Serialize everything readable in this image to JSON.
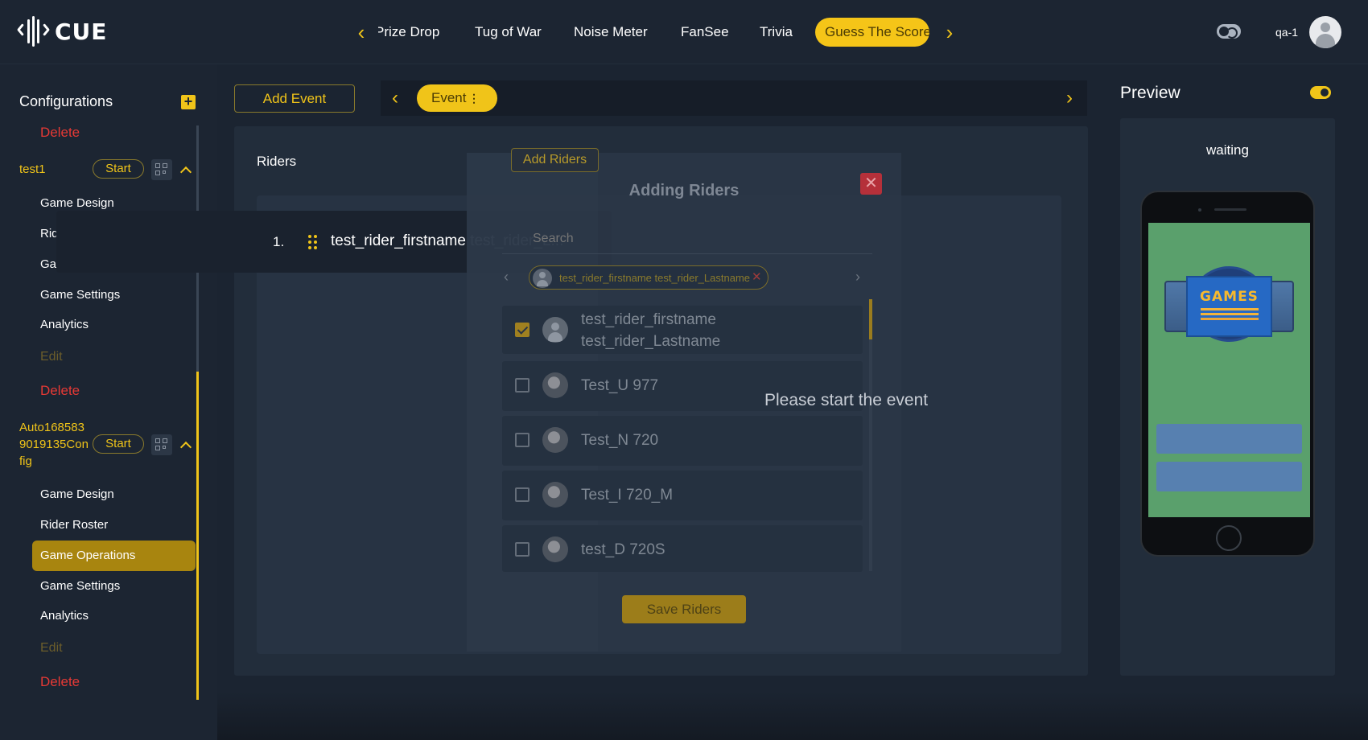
{
  "app": {
    "logo_text": "CUE"
  },
  "header": {
    "game_tabs": [
      "Prize Drop",
      "Tug of War",
      "Noise Meter",
      "FanSee",
      "Trivia",
      "Guess The Score"
    ],
    "active_tab": "Guess The Score",
    "user_name": "qa-1"
  },
  "sidebar": {
    "title": "Configurations",
    "top_delete": "Delete",
    "configs": [
      {
        "name": "test1",
        "start_label": "Start",
        "items": [
          "Game Design",
          "Rider Roster",
          "Game Operations",
          "Game Settings",
          "Analytics"
        ],
        "edit_label": "Edit",
        "delete_label": "Delete"
      },
      {
        "name_lines": [
          "Auto168583",
          "9019135Con",
          "fig"
        ],
        "start_label": "Start",
        "items": [
          "Game Design",
          "Rider Roster",
          "Game Operations",
          "Game Settings",
          "Analytics"
        ],
        "active_item": "Game Operations",
        "edit_label": "Edit",
        "delete_label": "Delete"
      }
    ]
  },
  "toolbar": {
    "add_event_label": "Add Event",
    "event_pill_label": "Event",
    "event_pill_menu": "⋮"
  },
  "riders_panel": {
    "label": "Riders",
    "rider": {
      "index": "1.",
      "name": "test_rider_firstname test_rider_L..."
    },
    "status_message": "Please start the event"
  },
  "modal": {
    "add_riders_label": "Add Riders",
    "title": "Adding Riders",
    "close_label": "✕",
    "search_placeholder": "Search",
    "selected_chip": "test_rider_firstname test_rider_Lastname",
    "rows": [
      {
        "name_lines": [
          "test_rider_firstname",
          "test_rider_Lastname"
        ],
        "checked": true
      },
      {
        "name_lines": [
          "Test_U 977"
        ],
        "checked": false
      },
      {
        "name_lines": [
          "Test_N 720"
        ],
        "checked": false
      },
      {
        "name_lines": [
          "Test_I 720_M"
        ],
        "checked": false
      },
      {
        "name_lines": [
          "test_D 720S"
        ],
        "checked": false
      }
    ],
    "save_label": "Save Riders"
  },
  "preview": {
    "title": "Preview",
    "status": "waiting",
    "game_logo_text": "GAMES"
  },
  "colors": {
    "accent": "#f0c419",
    "background": "#1b2431",
    "panel": "#222d3b",
    "danger": "#e53935",
    "phone_screen": "#5aa06c"
  },
  "icons": [
    "cue-logo-icon",
    "chevron-left-icon",
    "chevron-right-icon",
    "theme-toggle-icon",
    "user-avatar-icon",
    "plus-icon",
    "qr-code-icon",
    "chevron-up-icon",
    "drag-handle-icon",
    "close-icon",
    "search-icon",
    "checkbox-icon"
  ]
}
